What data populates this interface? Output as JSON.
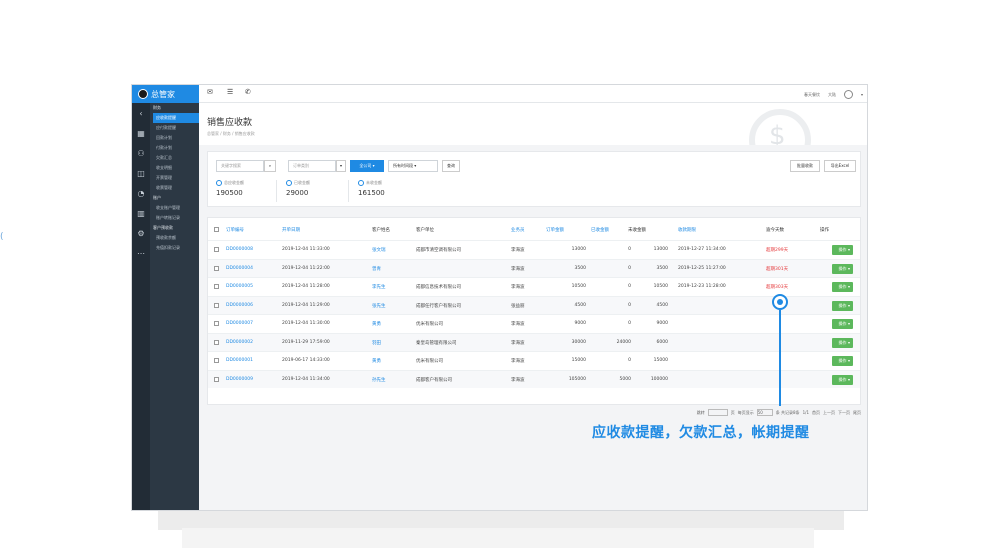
{
  "sidebar_glyph": "(",
  "app": {
    "name": "总管家"
  },
  "rail_icons": [
    "chevron-left-icon",
    "calendar-icon",
    "users-icon",
    "chart-icon",
    "clock-icon",
    "bar-chart-icon",
    "gear-icon",
    "more-icon"
  ],
  "menu": [
    {
      "label": "财务",
      "type": "group"
    },
    {
      "label": "应收款提醒",
      "type": "active"
    },
    {
      "label": "应付款提醒",
      "type": "item"
    },
    {
      "label": "回款计划",
      "type": "item"
    },
    {
      "label": "付款计划",
      "type": "item"
    },
    {
      "label": "欠款汇总",
      "type": "item"
    },
    {
      "label": "收支明细",
      "type": "item"
    },
    {
      "label": "开票管理",
      "type": "item"
    },
    {
      "label": "收票管理",
      "type": "item"
    },
    {
      "label": "账户",
      "type": "group"
    },
    {
      "label": "收支账户管理",
      "type": "item"
    },
    {
      "label": "账户转账记录",
      "type": "item"
    },
    {
      "label": "客户预收款",
      "type": "group"
    },
    {
      "label": "预收款余额",
      "type": "item"
    },
    {
      "label": "充值扣款记录",
      "type": "item"
    }
  ],
  "topbar": {
    "user": "春天餐饮",
    "lang": "大陆"
  },
  "page": {
    "title": "销售应收款",
    "breadcrumb": "总管家 / 财务 / 销售应收款"
  },
  "filters": {
    "keyword_placeholder": "关键字搜索",
    "order_type_placeholder": "订单类别",
    "company": "全公司",
    "period": "所有时间段",
    "query": "查询",
    "batch_collect": "批量收款",
    "export": "导出Excel"
  },
  "stats": [
    {
      "label": "总应收金额",
      "value": "190500"
    },
    {
      "label": "已收金额",
      "value": "29000"
    },
    {
      "label": "未收金额",
      "value": "161500"
    }
  ],
  "table": {
    "headers": [
      "订单编号",
      "开单日期",
      "客户姓名",
      "客户单位",
      "业务员",
      "订单金额",
      "已收金额",
      "未收金额",
      "收款期限",
      "逾今天数",
      "操作"
    ],
    "rows": [
      [
        "DD0000008",
        "2019-12-04 11:33:00",
        "张文瑞",
        "成都市清空调有限公司",
        "李海波",
        "13000",
        "0",
        "13000",
        "2019-12-27 11:34:00",
        "超期299天",
        "操作"
      ],
      [
        "DD0000004",
        "2019-12-04 11:22:00",
        "曾青",
        "",
        "李海波",
        "3500",
        "0",
        "3500",
        "2019-12-25 11:27:00",
        "超期301天",
        "操作"
      ],
      [
        "DD0000005",
        "2019-12-04 11:28:00",
        "李先生",
        "成都信息技术有限公司",
        "李海波",
        "10500",
        "0",
        "10500",
        "2019-12-23 11:28:00",
        "超期303天",
        "操作"
      ],
      [
        "DD0000006",
        "2019-12-04 11:29:00",
        "张先生",
        "成都任行客户有限公司",
        "张益丽",
        "4500",
        "0",
        "4500",
        "",
        "",
        "操作"
      ],
      [
        "DD0000007",
        "2019-12-04 11:30:00",
        "黄勇",
        "优米有限公司",
        "李海波",
        "9000",
        "0",
        "9000",
        "",
        "",
        "操作"
      ],
      [
        "DD0000002",
        "2019-11-29 17:59:00",
        "羽田",
        "秦皇岛管理有限公司",
        "李海波",
        "30000",
        "24000",
        "6000",
        "",
        "",
        "操作"
      ],
      [
        "DD0000001",
        "2019-06-17 14:33:00",
        "黄勇",
        "优米有限公司",
        "李海波",
        "15000",
        "0",
        "15000",
        "",
        "",
        "操作"
      ],
      [
        "DD0000009",
        "2019-12-04 11:34:00",
        "孙先生",
        "成都客户有限公司",
        "李海波",
        "105000",
        "5000",
        "100000",
        "",
        "",
        "操作"
      ]
    ]
  },
  "pager": {
    "goto": "跳转",
    "page_unit": "页",
    "per_page": "每页显示",
    "per_page_value": "50",
    "records": "条 共记录8条",
    "page_info": "1/1",
    "first": "首页",
    "prev": "上一页",
    "next": "下一页",
    "last": "尾页"
  },
  "callout": "应收款提醒，欠款汇总，帐期提醒",
  "colors": {
    "accent": "#1f8ae3",
    "sidebar": "#2c3844",
    "ok": "#5cb85c",
    "alert": "#e5383b"
  }
}
